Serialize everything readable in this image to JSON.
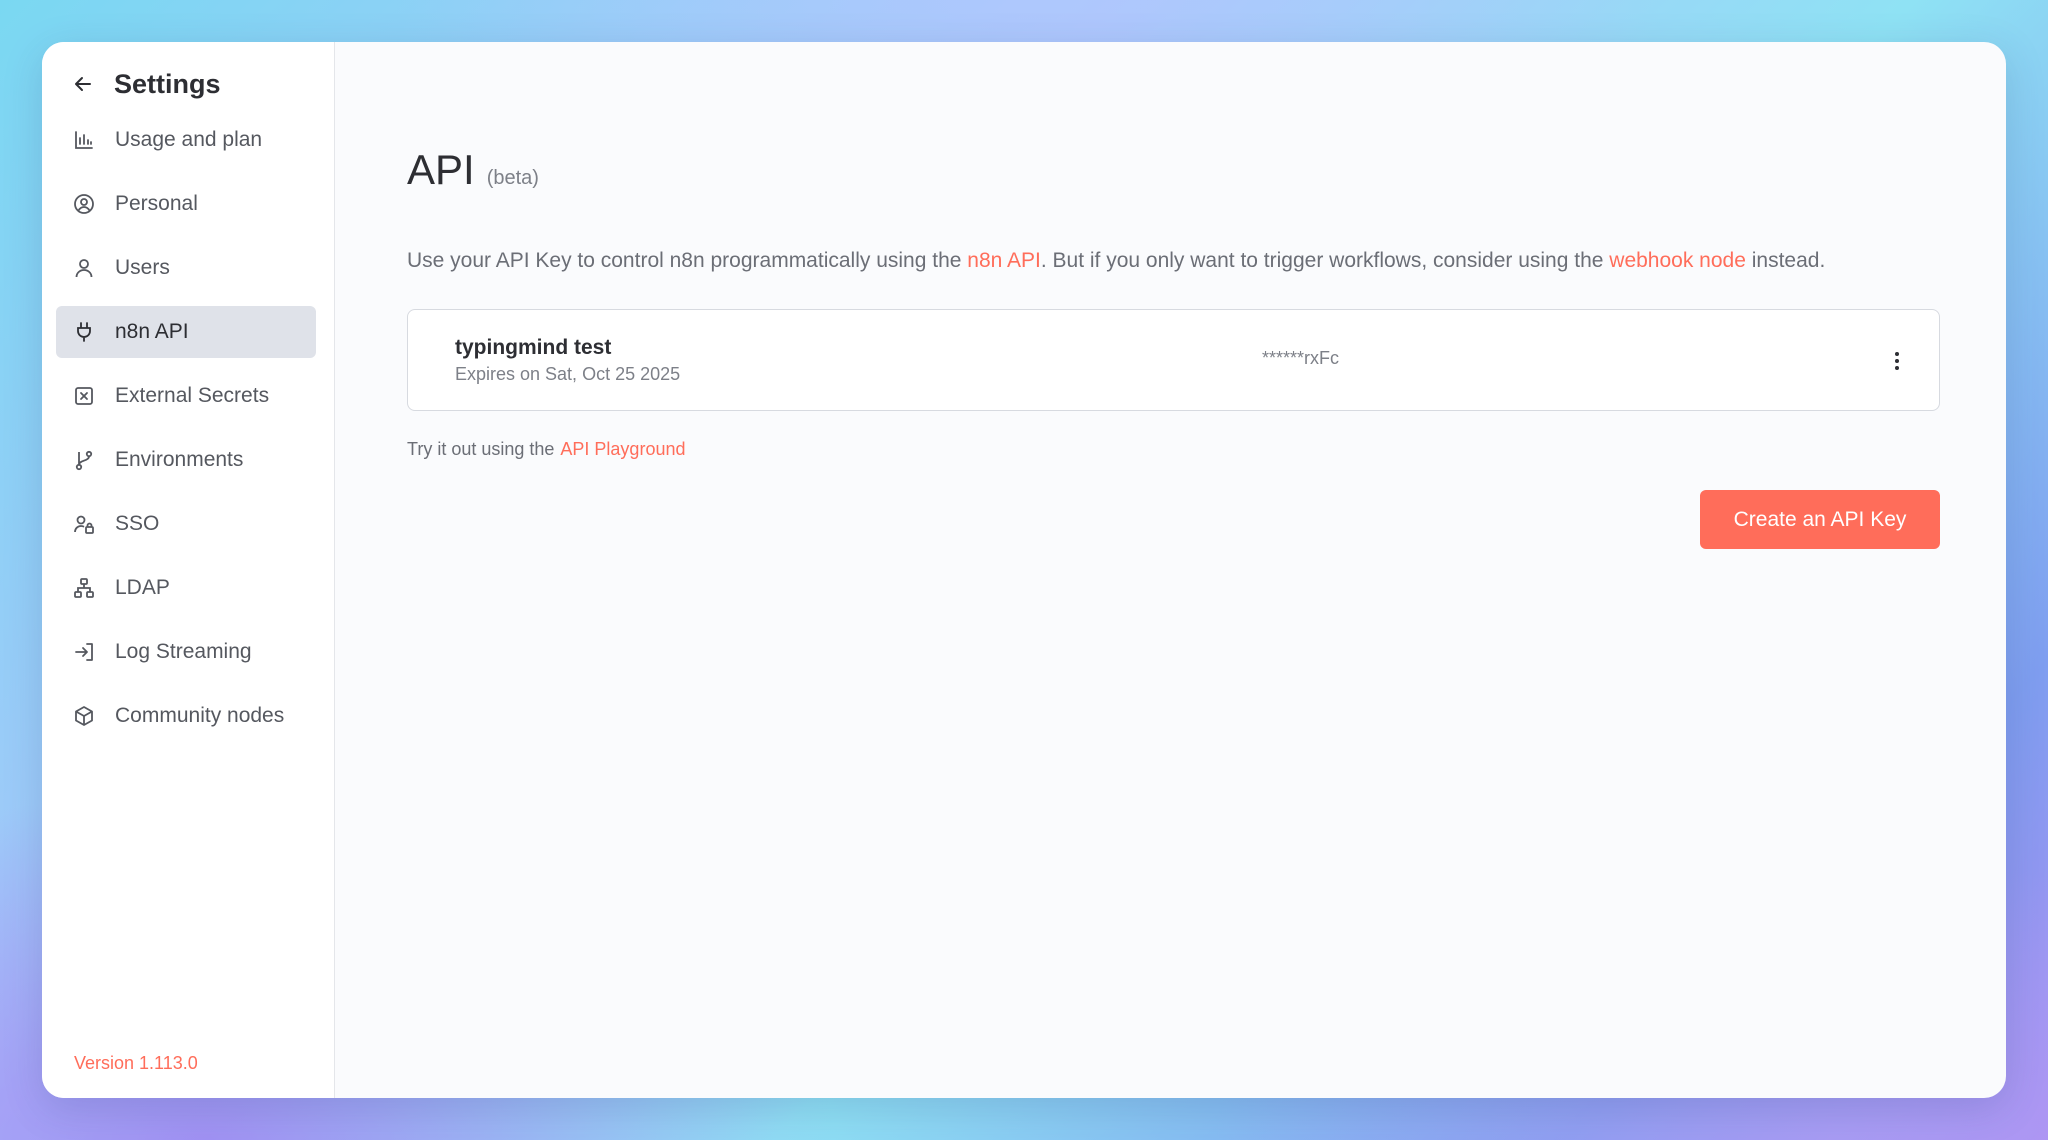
{
  "sidebar": {
    "title": "Settings",
    "items": [
      {
        "label": "Usage and plan",
        "icon": "bar-chart-icon"
      },
      {
        "label": "Personal",
        "icon": "user-circle-icon"
      },
      {
        "label": "Users",
        "icon": "user-icon"
      },
      {
        "label": "n8n API",
        "icon": "plug-icon",
        "active": true
      },
      {
        "label": "External Secrets",
        "icon": "vault-icon"
      },
      {
        "label": "Environments",
        "icon": "git-branch-icon"
      },
      {
        "label": "SSO",
        "icon": "user-lock-icon"
      },
      {
        "label": "LDAP",
        "icon": "network-icon"
      },
      {
        "label": "Log Streaming",
        "icon": "sign-in-icon"
      },
      {
        "label": "Community nodes",
        "icon": "cube-icon"
      }
    ],
    "version": "Version 1.113.0"
  },
  "main": {
    "title": "API",
    "subtitle": "(beta)",
    "description": {
      "part1": "Use your API Key to control n8n programmatically using the ",
      "link1": "n8n API",
      "part2": ". But if you only want to trigger workflows, consider using the ",
      "link2": "webhook node",
      "part3": " instead."
    },
    "api_key": {
      "name": "typingmind test",
      "expiry": "Expires on Sat, Oct 25 2025",
      "masked": "******rxFc"
    },
    "tryout": {
      "text": "Try it out using the",
      "link": "API Playground"
    },
    "create_button": "Create an API Key"
  },
  "colors": {
    "accent": "#ff6d5a",
    "active_bg": "#dfe2e9",
    "text_dark": "#2d2e33",
    "text_muted": "#7d8088"
  }
}
